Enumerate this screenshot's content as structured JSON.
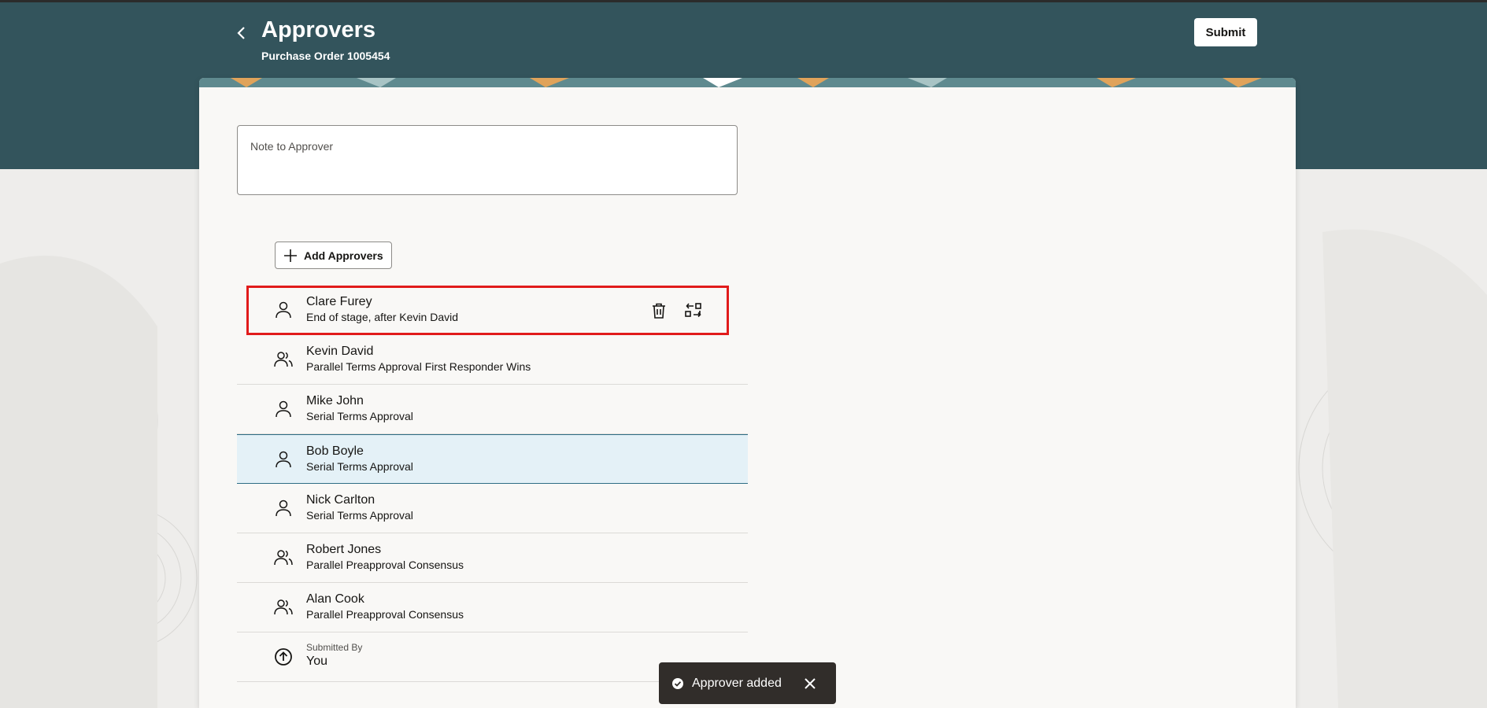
{
  "header": {
    "title": "Approvers",
    "subtitle": "Purchase Order 1005454",
    "submit_label": "Submit"
  },
  "note": {
    "label": "Note to Approver"
  },
  "add_approvers_label": "Add Approvers",
  "approvers": [
    {
      "name": "Clare Furey",
      "detail": "End of stage, after Kevin David",
      "icon": "person-icon"
    },
    {
      "name": "Kevin David",
      "detail": "Parallel Terms Approval First Responder Wins",
      "icon": "group-icon"
    },
    {
      "name": "Mike John",
      "detail": "Serial Terms Approval",
      "icon": "person-icon"
    },
    {
      "name": "Bob Boyle",
      "detail": "Serial Terms Approval",
      "icon": "person-icon"
    },
    {
      "name": "Nick Carlton",
      "detail": "Serial Terms Approval",
      "icon": "person-icon"
    },
    {
      "name": "Robert Jones",
      "detail": "Parallel Preapproval Consensus",
      "icon": "group-icon"
    },
    {
      "name": "Alan Cook",
      "detail": "Parallel Preapproval Consensus",
      "icon": "group-icon"
    }
  ],
  "submitted_by": {
    "label": "Submitted By",
    "value": "You"
  },
  "toast": {
    "message": "Approver added"
  },
  "colors": {
    "header_bg": "#33545c",
    "selected_row_bg": "#e4f1f7",
    "highlight_outline": "#e11b1b",
    "toast_bg": "#312d2a"
  }
}
